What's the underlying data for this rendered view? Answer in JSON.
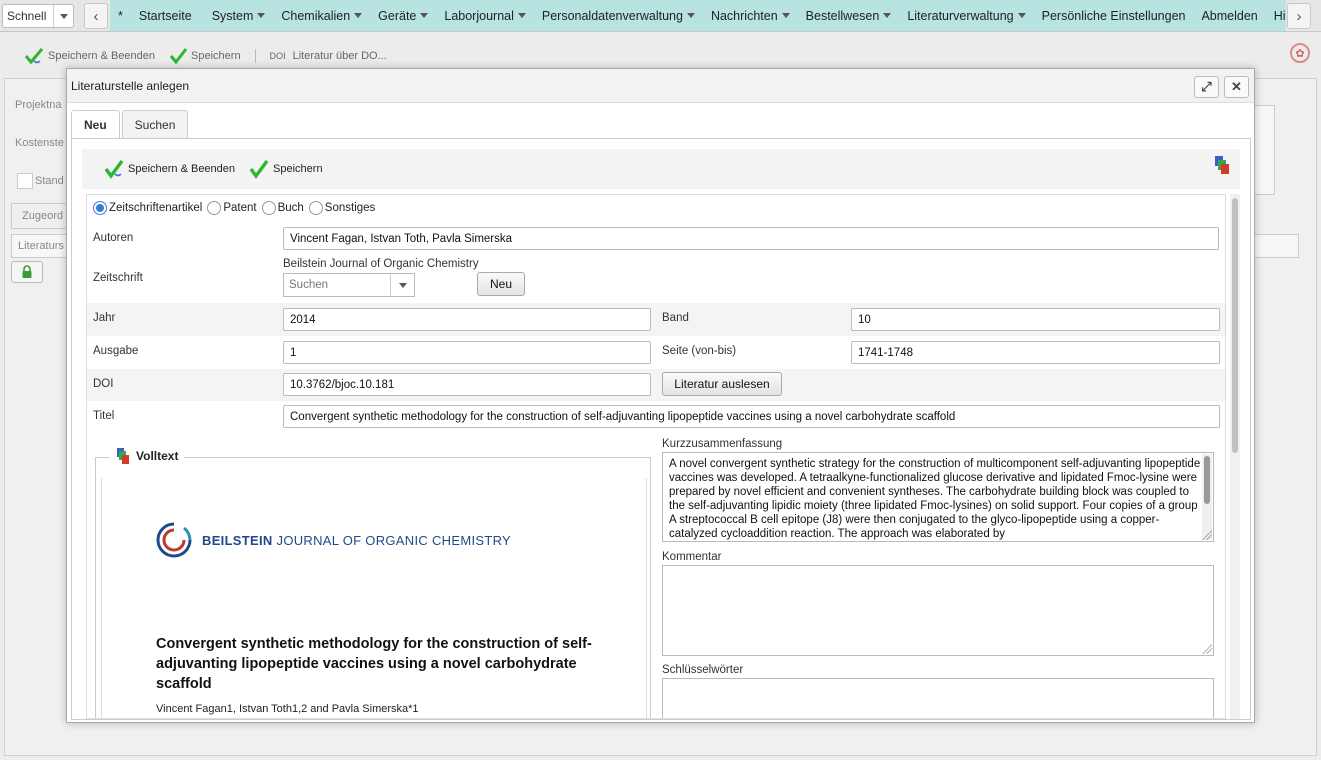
{
  "quick": {
    "label": "Schnell"
  },
  "nav": {
    "items": [
      {
        "label": "*",
        "dropdown": false
      },
      {
        "label": "Startseite",
        "dropdown": false
      },
      {
        "label": "System",
        "dropdown": true
      },
      {
        "label": "Chemikalien",
        "dropdown": true
      },
      {
        "label": "Geräte",
        "dropdown": true
      },
      {
        "label": "Laborjournal",
        "dropdown": true
      },
      {
        "label": "Personaldatenverwaltung",
        "dropdown": true
      },
      {
        "label": "Nachrichten",
        "dropdown": true
      },
      {
        "label": "Bestellwesen",
        "dropdown": true
      },
      {
        "label": "Literaturverwaltung",
        "dropdown": true
      },
      {
        "label": "Persönliche Einstellungen",
        "dropdown": false
      },
      {
        "label": "Abmelden",
        "dropdown": false
      },
      {
        "label": "Hilfe",
        "dropdown": false
      }
    ]
  },
  "page_toolbar": {
    "save_close": "Speichern & Beenden",
    "save": "Speichern",
    "doi_tag": "DOI",
    "doi_label": "Literatur über DO..."
  },
  "background": {
    "projekt": "Projektna",
    "kosten": "Kostenste",
    "stand": "Stand",
    "zugeord": "Zugeord",
    "literatur": "Literaturs"
  },
  "modal": {
    "title": "Literaturstelle anlegen",
    "tabs": {
      "new": "Neu",
      "search": "Suchen"
    },
    "toolbar": {
      "save_close": "Speichern & Beenden",
      "save": "Speichern"
    },
    "types": [
      {
        "label": "Zeitschriftenartikel",
        "selected": true
      },
      {
        "label": "Patent",
        "selected": false
      },
      {
        "label": "Buch",
        "selected": false
      },
      {
        "label": "Sonstiges",
        "selected": false
      }
    ],
    "form": {
      "authors_label": "Autoren",
      "authors_value": "Vincent Fagan, Istvan Toth, Pavla Simerska",
      "journal_label": "Zeitschrift",
      "journal_name": "Beilstein Journal of Organic Chemistry",
      "journal_search_placeholder": "Suchen",
      "journal_new": "Neu",
      "year_label": "Jahr",
      "year_value": "2014",
      "volume_label": "Band",
      "volume_value": "10",
      "issue_label": "Ausgabe",
      "issue_value": "1",
      "pages_label": "Seite (von-bis)",
      "pages_value": "1741-1748",
      "doi_label": "DOI",
      "doi_value": "10.3762/bjoc.10.181",
      "doi_button": "Literatur auslesen",
      "title_label": "Titel",
      "title_value": "Convergent synthetic methodology for the construction of self-adjuvanting lipopeptide vaccines using a novel carbohydrate scaffold",
      "fulltext_label": "Volltext",
      "abstract_label": "Kurzzusammenfassung",
      "abstract_value": "A novel convergent synthetic strategy for the construction of multicomponent self-adjuvanting lipopeptide vaccines was developed. A tetraalkyne-functionalized glucose derivative and lipidated Fmoc-lysine were prepared by novel efficient and convenient syntheses. The carbohydrate building block was coupled to the self-adjuvanting lipidic moiety (three lipidated Fmoc-lysines) on solid support. Four copies of a group A streptococcal B cell epitope (J8) were then conjugated to the glyco-lipopeptide using a copper-catalyzed cycloaddition reaction. The approach was elaborated by",
      "comment_label": "Kommentar",
      "keywords_label": "Schlüsselwörter"
    },
    "preview": {
      "journal_logo_text_bold": "BEILSTEIN",
      "journal_logo_text": " JOURNAL OF ORGANIC CHEMISTRY",
      "paper_title": "Convergent synthetic methodology for the construction of self-adjuvanting lipopeptide vaccines using a novel carbohydrate scaffold",
      "authors": "Vincent Fagan1, Istvan Toth1,2 and Pavla Simerska*1"
    }
  },
  "colors": {
    "menu_bg": "#b7e3e1",
    "check_green": "#2fb62f",
    "radio_blue": "#3b7bd4",
    "logo_blue": "#1f4a8a"
  }
}
